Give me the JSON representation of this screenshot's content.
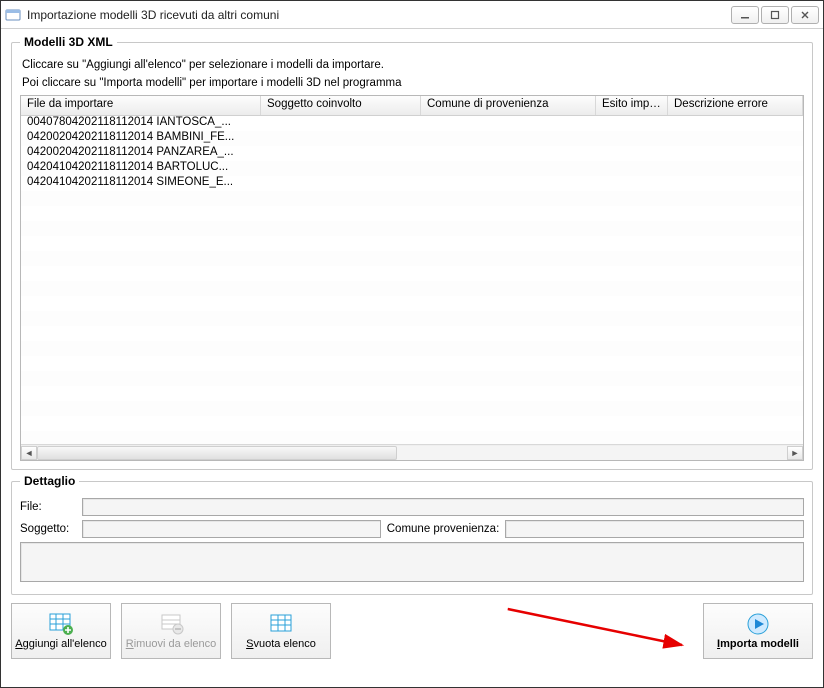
{
  "window": {
    "title": "Importazione modelli 3D ricevuti da altri comuni"
  },
  "group_main": {
    "legend": "Modelli 3D XML",
    "instr1": "Cliccare su \"Aggiungi all'elenco\" per selezionare i modelli da importare.",
    "instr2": "Poi cliccare su \"Importa modelli\" per importare i modelli 3D nel programma"
  },
  "columns": {
    "file": "File da importare",
    "soggetto": "Soggetto coinvolto",
    "comune": "Comune di provenienza",
    "esito": "Esito import",
    "errore": "Descrizione errore"
  },
  "rows": [
    {
      "file": "00407804202118112014 IANTOSCA_...",
      "soggetto": "",
      "comune": "",
      "esito": "",
      "errore": ""
    },
    {
      "file": "04200204202118112014 BAMBINI_FE...",
      "soggetto": "",
      "comune": "",
      "esito": "",
      "errore": ""
    },
    {
      "file": "04200204202118112014 PANZAREA_...",
      "soggetto": "",
      "comune": "",
      "esito": "",
      "errore": ""
    },
    {
      "file": "04204104202118112014 BARTOLUC...",
      "soggetto": "",
      "comune": "",
      "esito": "",
      "errore": ""
    },
    {
      "file": "04204104202118112014 SIMEONE_E...",
      "soggetto": "",
      "comune": "",
      "esito": "",
      "errore": ""
    }
  ],
  "detail": {
    "legend": "Dettaglio",
    "file_label": "File:",
    "file_value": "",
    "soggetto_label": "Soggetto:",
    "soggetto_value": "",
    "comune_label": "Comune provenienza:",
    "comune_value": "",
    "notes_value": ""
  },
  "buttons": {
    "aggiungi": "Aggiungi all'elenco",
    "rimuovi": "Rimuovi da elenco",
    "svuota": "Svuota elenco",
    "importa": "Importa modelli"
  }
}
